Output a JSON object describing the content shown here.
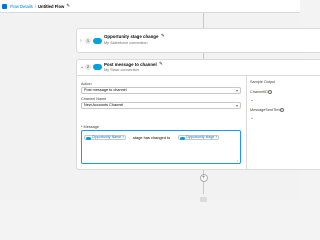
{
  "header": {
    "breadcrumb_link": "Flow Details",
    "breadcrumb_separator": "/",
    "flow_title": "Untitled Flow",
    "edit_icon": "pencil-icon"
  },
  "step1": {
    "number": "1",
    "title": "Opportunity stage change",
    "subtitle": "My Salesforce connection",
    "icon": "salesforce-cloud-icon"
  },
  "step2": {
    "number": "2",
    "title": "Post message to channel",
    "subtitle": "My Slack connection",
    "icon": "salesforce-cloud-icon",
    "action_label": "Action",
    "action_value": "Post message to channel",
    "channel_label": "Channel Name",
    "channel_value": "New Accounts Channel",
    "message_label": "Message",
    "message_required": "*",
    "message_pill_1": "Opportunity Name",
    "message_text": "stage has changed to",
    "message_pill_2": "Opportunity stage",
    "pill_remove": "×",
    "sample_output_label": "Sample Output",
    "output_field_1": "ChannelID",
    "output_field_2": "MessageSentTime"
  },
  "connectors": {
    "add_symbol": "+",
    "expand_symbol": "›",
    "collapse_symbol": "⌄",
    "dropdown_symbol": "▾"
  }
}
